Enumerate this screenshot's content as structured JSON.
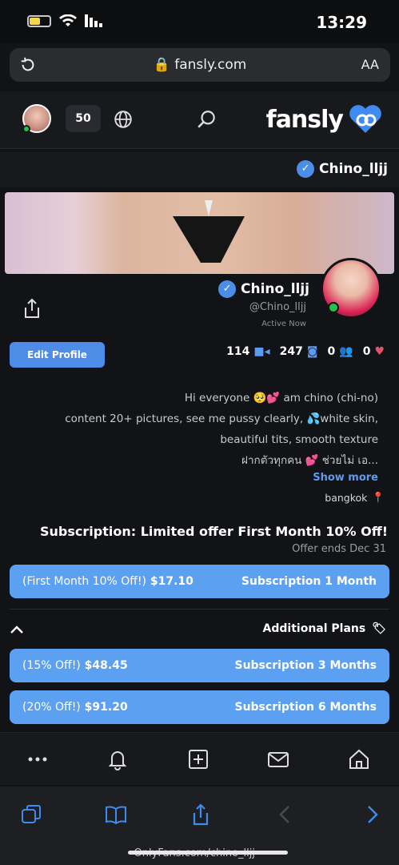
{
  "status_bar": {
    "time": "13:29"
  },
  "browser": {
    "url": "fansly.com",
    "reader_label": "AA",
    "bottom_url": "OnlyFans.com/chino_lljj"
  },
  "header": {
    "brand": "fansly",
    "notifications_count": "50"
  },
  "profile": {
    "strip_name": "Chino_lljj",
    "display_name": "Chino_lljj",
    "handle": "@Chino_lljj",
    "status": "Active Now",
    "edit_label": "Edit Profile",
    "stats": {
      "media": "114",
      "photos": "247",
      "subscribers": "0",
      "likes": "0"
    },
    "bio_lines": [
      "Hi everyone 🥺💕 am chino (chi-no)",
      "content 20+ pictures, see me pussy clearly, 💦white skin,",
      "beautiful tits, smooth texture",
      "ฝากตัวทุกคน 💕 ช่วยไม่ เอ..."
    ],
    "show_more": "Show more",
    "location": "bangkok"
  },
  "subscription": {
    "title": "Subscription: Limited offer First Month 10% Off!",
    "offer_ends": "Offer ends Dec 31",
    "primary_plan": {
      "name": "Subscription 1 Month",
      "price": "$17.10",
      "note": "(First Month 10% Off!)"
    },
    "additional_label": "Additional Plans",
    "plans": [
      {
        "name": "Subscription 3 Months",
        "price": "$48.45",
        "note": "(15% Off!)"
      },
      {
        "name": "Subscription 6 Months",
        "price": "$91.20",
        "note": "(20% Off!)"
      }
    ]
  },
  "colors": {
    "accent": "#5ca0f2",
    "background": "#121316",
    "online": "#27c24c"
  }
}
